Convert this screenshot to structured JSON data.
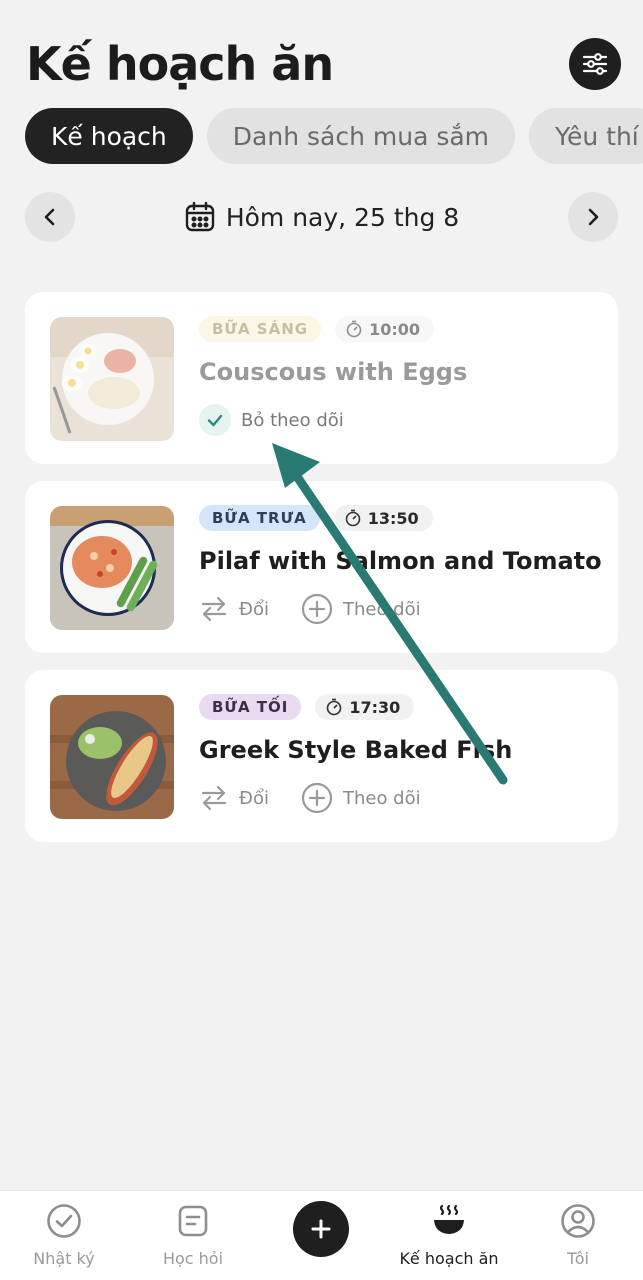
{
  "page": {
    "title": "Kế hoạch ăn"
  },
  "header": {
    "filter_icon": "sliders-icon"
  },
  "tabs": [
    {
      "label": "Kế hoạch",
      "active": true
    },
    {
      "label": "Danh sách mua sắm",
      "active": false
    },
    {
      "label": "Yêu thí",
      "active": false
    }
  ],
  "date_bar": {
    "label": "Hôm nay, 25 thg 8",
    "prev_icon": "chevron-left-icon",
    "next_icon": "chevron-right-icon",
    "calendar_icon": "calendar-icon"
  },
  "meals": [
    {
      "meal_type": "BỮA SÁNG",
      "time": "10:00",
      "title": "Couscous with Eggs",
      "chip_color": "#fbf0cf",
      "chip_text_color": "#9a8a5a",
      "tracked": true,
      "untrack_label": "Bỏ theo dõi"
    },
    {
      "meal_type": "BỮA TRƯA",
      "time": "13:50",
      "title": "Pilaf with Salmon and Tomato",
      "chip_color": "#d5e6fb",
      "chip_text_color": "#2d3e55",
      "tracked": false,
      "swap_label": "Đổi",
      "track_label": "Theo dõi"
    },
    {
      "meal_type": "BỮA TỐI",
      "time": "17:30",
      "title": "Greek Style Baked Fish",
      "chip_color": "#e9daf0",
      "chip_text_color": "#3d2f45",
      "tracked": false,
      "swap_label": "Đổi",
      "track_label": "Theo dõi"
    }
  ],
  "annotation": {
    "arrow_color": "#2a7a74"
  },
  "bottom_nav": [
    {
      "label": "Nhật ký",
      "icon": "check-circle-icon",
      "active": false
    },
    {
      "label": "Học hỏi",
      "icon": "note-icon",
      "active": false
    },
    {
      "label": "",
      "icon": "plus-icon",
      "active": false
    },
    {
      "label": "Kế hoạch ăn",
      "icon": "steaming-bowl-icon",
      "active": true
    },
    {
      "label": "Tôi",
      "icon": "user-circle-icon",
      "active": false
    }
  ]
}
